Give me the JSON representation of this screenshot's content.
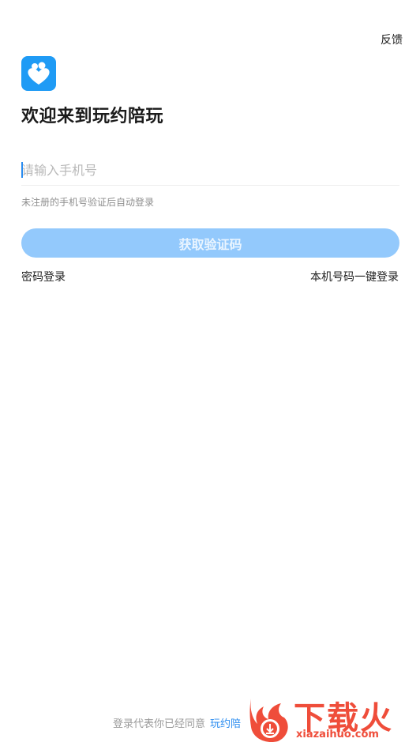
{
  "header": {
    "feedback_label": "反馈"
  },
  "welcome_title": "欢迎来到玩约陪玩",
  "phone": {
    "placeholder": "请输入手机号",
    "value": ""
  },
  "hint": "未注册的手机号验证后自动登录",
  "get_code_label": "获取验证码",
  "alt_login": {
    "password_login": "密码登录",
    "one_click_login": "本机号码一键登录"
  },
  "agreement": {
    "text": "登录代表你已经同意",
    "link": "玩约陪"
  },
  "watermark": {
    "title": "下载火",
    "url": "xiazaihuo.com"
  },
  "colors": {
    "accent": "#2a8cf0",
    "button_disabled": "#93c9fc",
    "logo_bg": "#1f9bf5",
    "watermark": "#ef4d3a"
  },
  "icons": {
    "logo": "heart-people-icon",
    "watermark": "download-icon"
  }
}
